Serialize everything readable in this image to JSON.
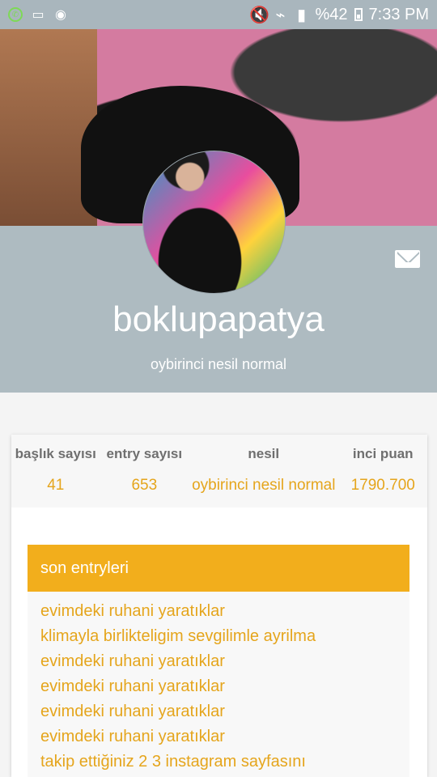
{
  "status_bar": {
    "battery": "%42",
    "time": "7:33 PM"
  },
  "profile": {
    "username": "boklupapatya",
    "generation_text": "oybirinci nesil normal"
  },
  "stats": [
    {
      "label": "başlık sayısı",
      "value": "41"
    },
    {
      "label": "entry sayısı",
      "value": "653"
    },
    {
      "label": "nesil",
      "value": "oybirinci nesil normal"
    },
    {
      "label": "inci puan",
      "value": "1790.700"
    }
  ],
  "entries": {
    "title": "son entryleri",
    "items": [
      "evimdeki ruhani yaratıklar",
      "klimayla birlikteligim sevgilimle ayrilma",
      "evimdeki ruhani yaratıklar",
      "evimdeki ruhani yaratıklar",
      "evimdeki ruhani yaratıklar",
      "evimdeki ruhani yaratıklar",
      "takip ettiğiniz 2 3 instagram sayfasını"
    ]
  },
  "colors": {
    "accent": "#f2ae1c",
    "band": "#aebbc1"
  }
}
